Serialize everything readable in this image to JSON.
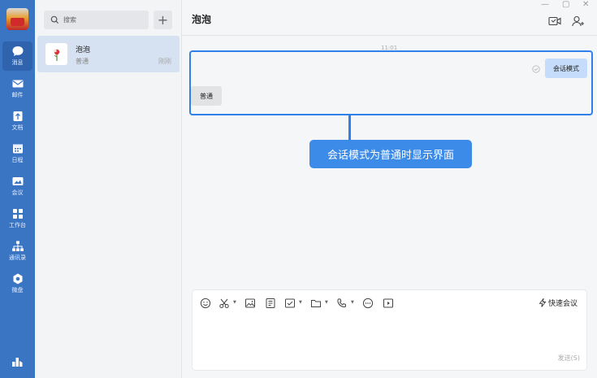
{
  "nav": {
    "items": [
      {
        "id": "messages",
        "label": "消息",
        "icon": "chat-bubble-icon",
        "active": true
      },
      {
        "id": "mail",
        "label": "邮件",
        "icon": "mail-icon"
      },
      {
        "id": "docs",
        "label": "文档",
        "icon": "document-icon"
      },
      {
        "id": "calendar",
        "label": "日程",
        "icon": "calendar-icon"
      },
      {
        "id": "meeting",
        "label": "会议",
        "icon": "meeting-icon"
      },
      {
        "id": "workbench",
        "label": "工作台",
        "icon": "grid-icon"
      },
      {
        "id": "contacts",
        "label": "通讯录",
        "icon": "org-chart-icon"
      },
      {
        "id": "drive",
        "label": "微盘",
        "icon": "cloud-drive-icon"
      }
    ]
  },
  "list": {
    "search_placeholder": "搜索",
    "add_label": "+",
    "conversations": [
      {
        "name": "泡泡",
        "subtitle": "普通",
        "time": "刚刚"
      }
    ]
  },
  "chat": {
    "title": "泡泡",
    "timestamp": "11:01",
    "outgoing_message": "会话模式",
    "incoming_message": "普通",
    "callout": "会话模式为普通时显示界面"
  },
  "composer": {
    "quick_meeting": "快速会议",
    "send_label": "发送(S)"
  },
  "colors": {
    "nav_bg": "#3a75c4",
    "accent": "#2f80e8",
    "callout_bg": "#3d8be8",
    "outgoing_bubble": "#c5dcfa"
  }
}
